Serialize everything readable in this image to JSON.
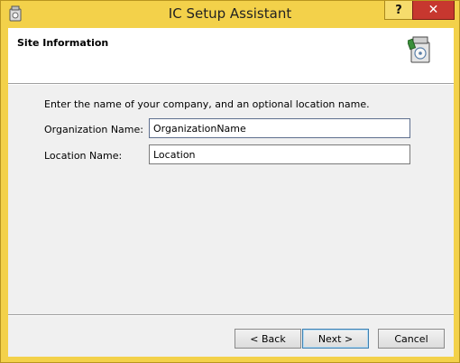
{
  "window": {
    "title": "IC Setup Assistant",
    "help_label": "?",
    "close_label": "✕"
  },
  "header": {
    "title": "Site Information"
  },
  "form": {
    "instructions": "Enter the name of your company, and an optional location name.",
    "organization": {
      "label": "Organization Name:",
      "value": "OrganizationName"
    },
    "location": {
      "label": "Location Name:",
      "value": "Location"
    }
  },
  "buttons": {
    "back": "< Back",
    "next": "Next >",
    "cancel": "Cancel"
  },
  "icons": {
    "app": "setup-app-icon",
    "header": "setup-install-icon"
  },
  "colors": {
    "titlebar": "#f3d14a",
    "close_button": "#c7372f",
    "dialog_background": "#f0f0f0"
  }
}
